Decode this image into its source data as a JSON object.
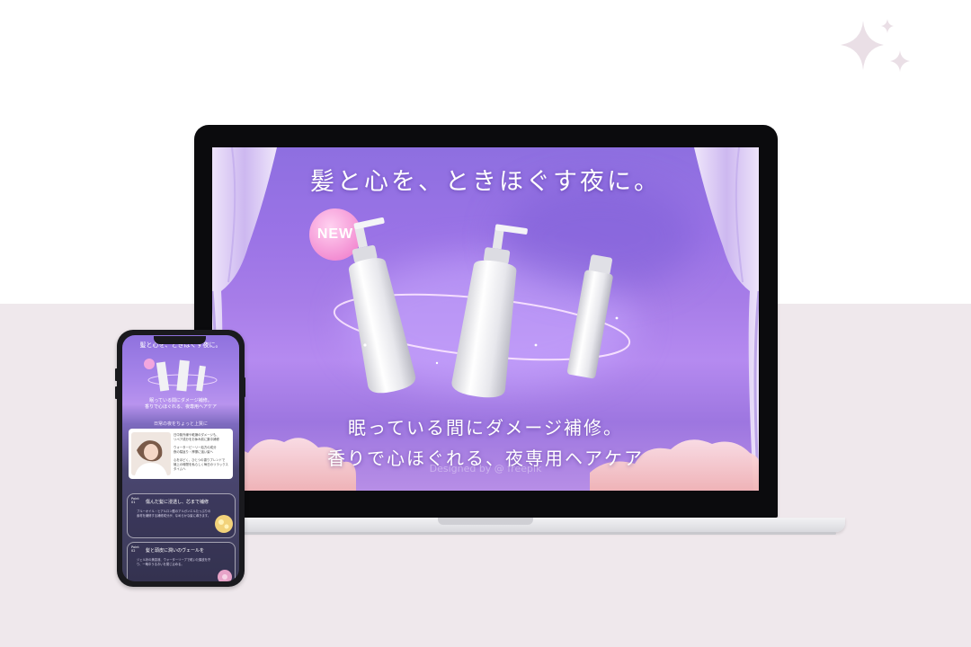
{
  "laptop": {
    "hero_title": "髪と心を、ときほぐす夜に。",
    "badge": "NEW",
    "tagline_line1": "眠っている間にダメージ補修。",
    "tagline_line2": "香りで心ほぐれる、夜専用ヘアケア",
    "watermark": "Designed by @ freepik"
  },
  "phone": {
    "title": "髪と心を、ときほぐす夜に。",
    "tagline_line1": "眠っている間にダメージ補修。",
    "tagline_line2": "香りで心ほぐれる、夜専用ヘアケア",
    "section_heading": "日常の夜をちょっと上質に",
    "card_lines": [
      "日中紫外線や乾燥のダメージも、",
      "リペア成分をお休み前に集中補修",
      "ウォーターピーリー処方の成分",
      "夜の寝返り・摩擦に強い髪へ",
      "心をほどく、ひとつの香りブレンドで",
      "極上の時間を私らしく毎日のリラックスタイムへ"
    ],
    "points": [
      {
        "label": "Point 01",
        "title": "傷んだ髪に浸透し、芯まで補修",
        "text": "ブルーオイル・ヒアルロン酸のアルガンエルたっぷりの素材を補修する補修成分が、なめらかな髪に導きます。"
      },
      {
        "label": "Point 02",
        "title": "髪と頭皮に潤いのヴェールを",
        "text": "ジェル状の美容液、ウォーターリーブで乾いた頭皮を守り、一晩中うるおいを閉じ込める。"
      }
    ]
  },
  "colors": {
    "page_bottom": "#efe8ec",
    "hero_purple": "#a77de8",
    "badge_pink": "#f38fd3",
    "laptop_bezel": "#0b0b0d"
  }
}
